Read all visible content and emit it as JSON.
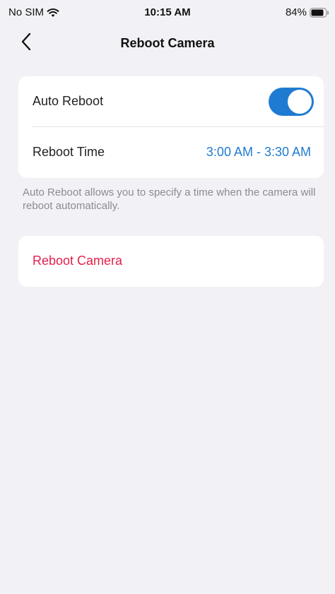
{
  "status_bar": {
    "carrier": "No SIM",
    "time": "10:15 AM",
    "battery_percent": "84%",
    "battery_level": 0.84,
    "wifi_icon": "wifi-icon",
    "battery_icon": "battery-icon"
  },
  "nav": {
    "title": "Reboot Camera",
    "back_icon": "chevron-left-icon"
  },
  "settings": {
    "auto_reboot": {
      "label": "Auto Reboot",
      "enabled": true
    },
    "reboot_time": {
      "label": "Reboot Time",
      "value": "3:00 AM - 3:30 AM"
    },
    "footnote": "Auto Reboot allows you to specify a time when the camera will reboot automatically."
  },
  "actions": {
    "reboot_label": "Reboot Camera"
  },
  "colors": {
    "accent": "#1f7bd1",
    "destructive": "#e51f4b",
    "background": "#f2f2f6",
    "secondary_text": "#8b8b90"
  }
}
